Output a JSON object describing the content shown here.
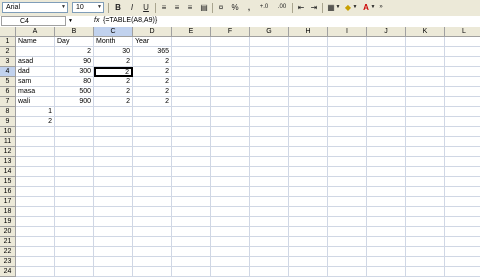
{
  "toolbar": {
    "font_name": "Arial",
    "font_size": "10",
    "bold": "B",
    "italic": "I",
    "underline": "U",
    "percent": "%",
    "comma": ",",
    "currency_decimals_1": "+.0",
    "currency_decimals_2": ".00"
  },
  "formula_bar": {
    "name_box": "C4",
    "fx": "fx",
    "formula": "{=TABLE(A8,A9)}"
  },
  "sheet": {
    "columns": [
      "A",
      "B",
      "C",
      "D",
      "E",
      "F",
      "G",
      "H",
      "I",
      "J",
      "K",
      "L"
    ],
    "rows": [
      "1",
      "2",
      "3",
      "4",
      "5",
      "6",
      "7",
      "8",
      "9",
      "10",
      "11",
      "12",
      "13",
      "14",
      "15",
      "16",
      "17",
      "18",
      "19",
      "20",
      "21",
      "22",
      "23",
      "24"
    ],
    "active_cell": "C4",
    "cells": {
      "A1": "Name",
      "B1": "Day",
      "C1": "Month",
      "D1": "Year",
      "B2": "2",
      "C2": "30",
      "D2": "365",
      "A3": "asad",
      "B3": "90",
      "C3": "2",
      "D3": "2",
      "A4": "dad",
      "B4": "300",
      "C4": "2",
      "D4": "2",
      "A5": "sam",
      "B5": "80",
      "C5": "2",
      "D5": "2",
      "A6": "masa",
      "B6": "500",
      "C6": "2",
      "D6": "2",
      "A7": "wali",
      "B7": "900",
      "C7": "2",
      "D7": "2",
      "A8": "1",
      "A9": "2"
    }
  },
  "colors": {
    "header_bg": "#ece9d8",
    "active_header_bg": "#c1d2ee",
    "gridline": "#d0d7e5"
  }
}
